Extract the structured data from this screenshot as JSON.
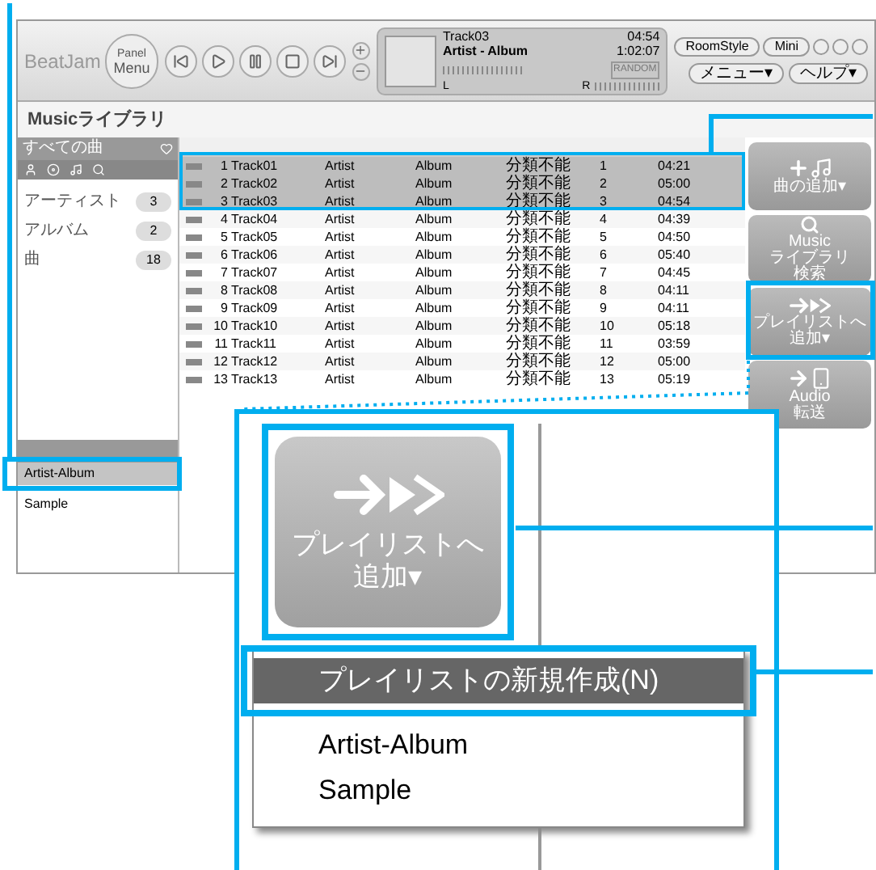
{
  "toolbar": {
    "logo": "BeatJam",
    "panel_menu": {
      "line1": "Panel",
      "line2": "Menu"
    },
    "transport": [
      {
        "kind": "prev"
      },
      {
        "kind": "play"
      },
      {
        "kind": "pause"
      },
      {
        "kind": "stop"
      },
      {
        "kind": "next"
      }
    ],
    "display": {
      "title": "Track03",
      "subtitle": "Artist - Album",
      "time": "04:54",
      "total": "1:02:07",
      "random": "RANDOM",
      "left": "L",
      "right": "R"
    },
    "buttons": [
      {
        "label": "RoomStyle"
      },
      {
        "label": "Mini"
      }
    ],
    "menus": [
      {
        "label": "メニュー▾"
      },
      {
        "label": "ヘルプ▾"
      }
    ]
  },
  "library": {
    "title": "Musicライブラリ",
    "sidebar": {
      "header": "すべての曲",
      "stats": [
        {
          "label": "アーティスト",
          "count": "3"
        },
        {
          "label": "アルバム",
          "count": "2"
        },
        {
          "label": "曲",
          "count": "18"
        }
      ],
      "playlists": [
        {
          "label": "Artist-Album",
          "selected": true
        },
        {
          "label": "Sample",
          "selected": false
        }
      ]
    },
    "table": {
      "rows": [
        {
          "no": "1",
          "title": "Track01",
          "artist": "Artist",
          "album": "Album",
          "genre": "分類不能",
          "track": "1",
          "time": "04:21",
          "selected": true
        },
        {
          "no": "2",
          "title": "Track02",
          "artist": "Artist",
          "album": "Album",
          "genre": "分類不能",
          "track": "2",
          "time": "05:00",
          "selected": true
        },
        {
          "no": "3",
          "title": "Track03",
          "artist": "Artist",
          "album": "Album",
          "genre": "分類不能",
          "track": "3",
          "time": "04:54",
          "selected": true
        },
        {
          "no": "4",
          "title": "Track04",
          "artist": "Artist",
          "album": "Album",
          "genre": "分類不能",
          "track": "4",
          "time": "04:39",
          "selected": false
        },
        {
          "no": "5",
          "title": "Track05",
          "artist": "Artist",
          "album": "Album",
          "genre": "分類不能",
          "track": "5",
          "time": "04:50",
          "selected": false
        },
        {
          "no": "6",
          "title": "Track06",
          "artist": "Artist",
          "album": "Album",
          "genre": "分類不能",
          "track": "6",
          "time": "05:40",
          "selected": false
        },
        {
          "no": "7",
          "title": "Track07",
          "artist": "Artist",
          "album": "Album",
          "genre": "分類不能",
          "track": "7",
          "time": "04:45",
          "selected": false
        },
        {
          "no": "8",
          "title": "Track08",
          "artist": "Artist",
          "album": "Album",
          "genre": "分類不能",
          "track": "8",
          "time": "04:11",
          "selected": false
        },
        {
          "no": "9",
          "title": "Track09",
          "artist": "Artist",
          "album": "Album",
          "genre": "分類不能",
          "track": "9",
          "time": "04:11",
          "selected": false
        },
        {
          "no": "10",
          "title": "Track10",
          "artist": "Artist",
          "album": "Album",
          "genre": "分類不能",
          "track": "10",
          "time": "05:18",
          "selected": false
        },
        {
          "no": "11",
          "title": "Track11",
          "artist": "Artist",
          "album": "Album",
          "genre": "分類不能",
          "track": "11",
          "time": "03:59",
          "selected": false
        },
        {
          "no": "12",
          "title": "Track12",
          "artist": "Artist",
          "album": "Album",
          "genre": "分類不能",
          "track": "12",
          "time": "05:00",
          "selected": false
        },
        {
          "no": "13",
          "title": "Track13",
          "artist": "Artist",
          "album": "Album",
          "genre": "分類不能",
          "track": "13",
          "time": "05:19",
          "selected": false
        }
      ]
    },
    "actions": [
      {
        "kind": "add",
        "lines": [
          "曲の追加▾"
        ]
      },
      {
        "kind": "search",
        "lines": [
          "Music",
          "ライブラリ",
          "検索"
        ]
      },
      {
        "kind": "playlist",
        "lines": [
          "プレイリストへ",
          "追加▾"
        ]
      },
      {
        "kind": "transfer",
        "lines": [
          "Audio",
          "転送"
        ]
      }
    ]
  },
  "detail": {
    "button": {
      "line1": "プレイリストへ",
      "line2": "追加▾"
    },
    "menu": [
      {
        "label": "プレイリストの新規作成(N)",
        "selected": true
      },
      {
        "label": "Artist-Album",
        "selected": false
      },
      {
        "label": "Sample",
        "selected": false
      }
    ]
  }
}
